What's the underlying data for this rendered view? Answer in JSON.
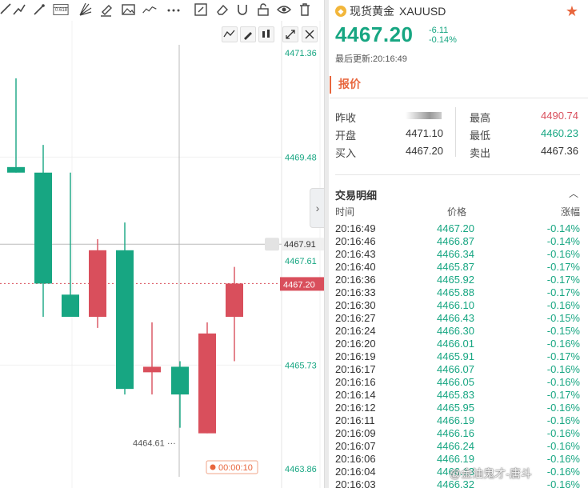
{
  "toolbar": {
    "icons": [
      "ruler-icon",
      "trend-line-icon",
      "ray-icon",
      "pitchfork-icon",
      "fibonacci-icon",
      "brush-icon",
      "image-icon",
      "indicator-line-icon",
      "more-icon",
      "edit-icon",
      "eraser-icon",
      "magnet-icon",
      "lock-icon",
      "eye-icon",
      "trash-icon"
    ],
    "fib_label": "0.618"
  },
  "chart": {
    "price_labels": [
      "4471.36",
      "4469.48",
      "4467.91",
      "4467.61",
      "4467.20",
      "4465.73",
      "4463.86"
    ],
    "low_annotation": "4464.61",
    "countdown": "00:00:10",
    "up_color": "#d94f5c",
    "down_color": "#17a682"
  },
  "chart_data": {
    "type": "candlestick",
    "candles": [
      {
        "open": 4469.3,
        "high": 4470.9,
        "low": 4469.2,
        "close": 4469.2,
        "dir": "down"
      },
      {
        "open": 4469.2,
        "high": 4469.7,
        "low": 4466.6,
        "close": 4467.2,
        "dir": "down"
      },
      {
        "open": 4467.0,
        "high": 4469.2,
        "low": 4466.7,
        "close": 4466.6,
        "dir": "down"
      },
      {
        "open": 4466.6,
        "high": 4468.0,
        "low": 4466.4,
        "close": 4467.8,
        "dir": "up"
      },
      {
        "open": 4467.8,
        "high": 4468.3,
        "low": 4465.2,
        "close": 4465.3,
        "dir": "down"
      },
      {
        "open": 4465.6,
        "high": 4466.5,
        "low": 4465.2,
        "close": 4465.7,
        "dir": "up"
      },
      {
        "open": 4465.7,
        "high": 4465.8,
        "low": 4464.6,
        "close": 4465.2,
        "dir": "down"
      },
      {
        "open": 4464.5,
        "high": 4466.5,
        "low": 4464.5,
        "close": 4466.3,
        "dir": "up"
      },
      {
        "open": 4466.6,
        "high": 4467.5,
        "low": 4465.8,
        "close": 4467.2,
        "dir": "up"
      }
    ]
  },
  "quote": {
    "symbol_name": "现货黄金",
    "symbol_code": "XAUUSD",
    "last": "4467.20",
    "change": "-6.11",
    "change_pct": "-0.14%",
    "updated": "最后更新:20:16:49",
    "tab": "报价",
    "left_rows": [
      {
        "label": "昨收",
        "value": ""
      },
      {
        "label": "开盘",
        "value": "4471.10"
      },
      {
        "label": "买入",
        "value": "4467.20"
      }
    ],
    "right_rows": [
      {
        "label": "最高",
        "value": "4490.74",
        "color": "#d94f5c"
      },
      {
        "label": "最低",
        "value": "4460.23",
        "color": "#17a682"
      },
      {
        "label": "卖出",
        "value": "4467.36",
        "color": "#333"
      }
    ]
  },
  "trades": {
    "title": "交易明细",
    "headers": {
      "time": "时间",
      "price": "价格",
      "change": "涨幅"
    },
    "rows": [
      {
        "time": "20:16:49",
        "price": "4467.20",
        "change": "-0.14%"
      },
      {
        "time": "20:16:46",
        "price": "4466.87",
        "change": "-0.14%"
      },
      {
        "time": "20:16:43",
        "price": "4466.34",
        "change": "-0.16%"
      },
      {
        "time": "20:16:40",
        "price": "4465.87",
        "change": "-0.17%"
      },
      {
        "time": "20:16:36",
        "price": "4465.92",
        "change": "-0.17%"
      },
      {
        "time": "20:16:33",
        "price": "4465.88",
        "change": "-0.17%"
      },
      {
        "time": "20:16:30",
        "price": "4466.10",
        "change": "-0.16%"
      },
      {
        "time": "20:16:27",
        "price": "4466.43",
        "change": "-0.15%"
      },
      {
        "time": "20:16:24",
        "price": "4466.30",
        "change": "-0.15%"
      },
      {
        "time": "20:16:20",
        "price": "4466.01",
        "change": "-0.16%"
      },
      {
        "time": "20:16:19",
        "price": "4465.91",
        "change": "-0.17%"
      },
      {
        "time": "20:16:17",
        "price": "4466.07",
        "change": "-0.16%"
      },
      {
        "time": "20:16:16",
        "price": "4466.05",
        "change": "-0.16%"
      },
      {
        "time": "20:16:14",
        "price": "4465.83",
        "change": "-0.17%"
      },
      {
        "time": "20:16:12",
        "price": "4465.95",
        "change": "-0.16%"
      },
      {
        "time": "20:16:11",
        "price": "4466.19",
        "change": "-0.16%"
      },
      {
        "time": "20:16:09",
        "price": "4466.16",
        "change": "-0.16%"
      },
      {
        "time": "20:16:07",
        "price": "4466.24",
        "change": "-0.16%"
      },
      {
        "time": "20:16:06",
        "price": "4466.19",
        "change": "-0.16%"
      },
      {
        "time": "20:16:04",
        "price": "4466.13",
        "change": "-0.16%"
      },
      {
        "time": "20:16:03",
        "price": "4466.32",
        "change": "-0.16%"
      }
    ]
  },
  "watermark": "@金油鬼才-唐斗"
}
